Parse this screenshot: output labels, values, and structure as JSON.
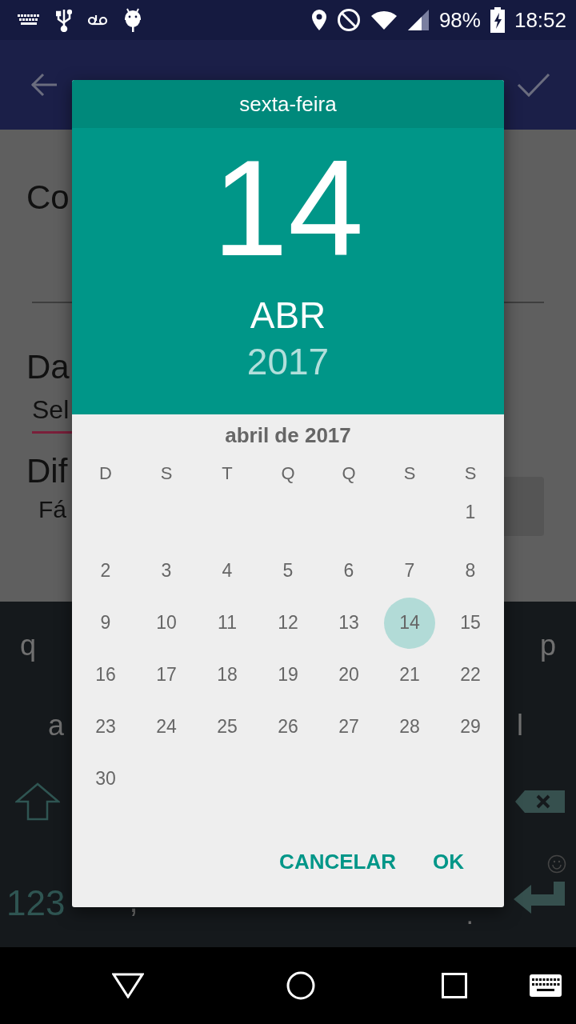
{
  "status_bar": {
    "battery": "98%",
    "time": "18:52"
  },
  "form": {
    "field_1": "Co",
    "field_2_label": "Da",
    "field_2_value": "Sel",
    "field_3_label": "Dif",
    "field_3_value": "Fá"
  },
  "keyboard": {
    "row_1": [
      "q",
      "p"
    ],
    "row_2": [
      "a",
      "l"
    ],
    "row_4": [
      "123",
      ",",
      "."
    ]
  },
  "dialog": {
    "weekday": "sexta-feira",
    "day": "14",
    "month": "ABR",
    "year": "2017",
    "month_title": "abril de 2017",
    "weekdays": [
      "D",
      "S",
      "T",
      "Q",
      "Q",
      "S",
      "S"
    ],
    "weeks": [
      {
        "days": [
          {
            "label": "1",
            "selected": false
          }
        ]
      },
      {
        "days": [
          {
            "label": "2",
            "selected": false
          },
          {
            "label": "3",
            "selected": false
          },
          {
            "label": "4",
            "selected": false
          },
          {
            "label": "5",
            "selected": false
          },
          {
            "label": "6",
            "selected": false
          },
          {
            "label": "7",
            "selected": false
          },
          {
            "label": "8",
            "selected": false
          }
        ]
      },
      {
        "days": [
          {
            "label": "9",
            "selected": false
          },
          {
            "label": "10",
            "selected": false
          },
          {
            "label": "11",
            "selected": false
          },
          {
            "label": "12",
            "selected": false
          },
          {
            "label": "13",
            "selected": false
          },
          {
            "label": "14",
            "selected": true
          },
          {
            "label": "15",
            "selected": false
          }
        ]
      },
      {
        "days": [
          {
            "label": "16",
            "selected": false
          },
          {
            "label": "17",
            "selected": false
          },
          {
            "label": "18",
            "selected": false
          },
          {
            "label": "19",
            "selected": false
          },
          {
            "label": "20",
            "selected": false
          },
          {
            "label": "21",
            "selected": false
          },
          {
            "label": "22",
            "selected": false
          }
        ]
      },
      {
        "days": [
          {
            "label": "23",
            "selected": false
          },
          {
            "label": "24",
            "selected": false
          },
          {
            "label": "25",
            "selected": false
          },
          {
            "label": "26",
            "selected": false
          },
          {
            "label": "27",
            "selected": false
          },
          {
            "label": "28",
            "selected": false
          },
          {
            "label": "29",
            "selected": false
          }
        ]
      },
      {
        "days": [
          {
            "label": "30",
            "selected": false
          }
        ]
      }
    ],
    "buttons": [
      "CANCELAR",
      "OK"
    ]
  }
}
